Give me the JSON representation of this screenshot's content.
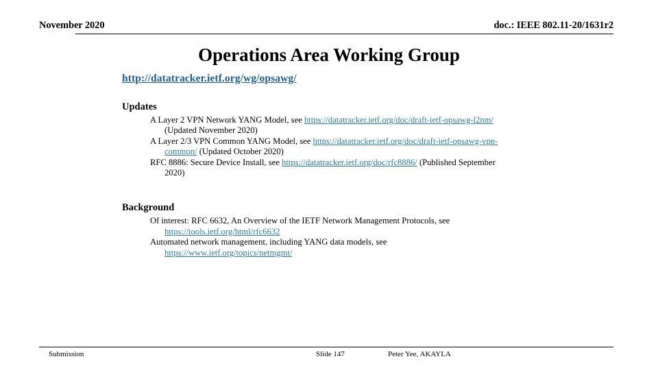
{
  "header": {
    "date": "November 2020",
    "doc_id": "doc.: IEEE 802.11-20/1631r2"
  },
  "title": "Operations Area Working Group",
  "main_link": {
    "text": "http://datatracker.ietf.org/wg/opsawg/",
    "color": "#1f5c8b"
  },
  "sections": [
    {
      "heading": "Updates",
      "items": [
        {
          "pre": "A Layer 2 VPN Network YANG Model, see ",
          "link": "https://datatracker.ietf.org/doc/draft-ietf-opsawg-l2nm/",
          "wrap_text": "(Updated November 2020)"
        },
        {
          "pre": "A Layer 2/3 VPN Common YANG Model, see ",
          "link": "https://datatracker.ietf.org/doc/draft-ietf-opsawg-vpn-",
          "wrap_link": "common/",
          "wrap_text": " (Updated October 2020)"
        },
        {
          "pre": "RFC 8886: Secure Device Install, see ",
          "link": "https://datatracker.ietf.org/doc/rfc8886/",
          "post": " (Published September",
          "wrap_text": "2020)"
        }
      ]
    },
    {
      "heading": "Background",
      "items": [
        {
          "pre": "Of interest: RFC 6632, An Overview of the IETF Network Management Protocols, see",
          "wrap_link": "https://tools.ietf.org/html/rfc6632"
        },
        {
          "pre": "Automated network management, including YANG data models, see",
          "wrap_link": "https://www.ietf.org/topics/netmgmt/"
        }
      ]
    }
  ],
  "link_color": "#2e7a9e",
  "footer": {
    "submission": "Submission",
    "slide": "Slide 147",
    "author": "Peter Yee, AKAYLA"
  }
}
